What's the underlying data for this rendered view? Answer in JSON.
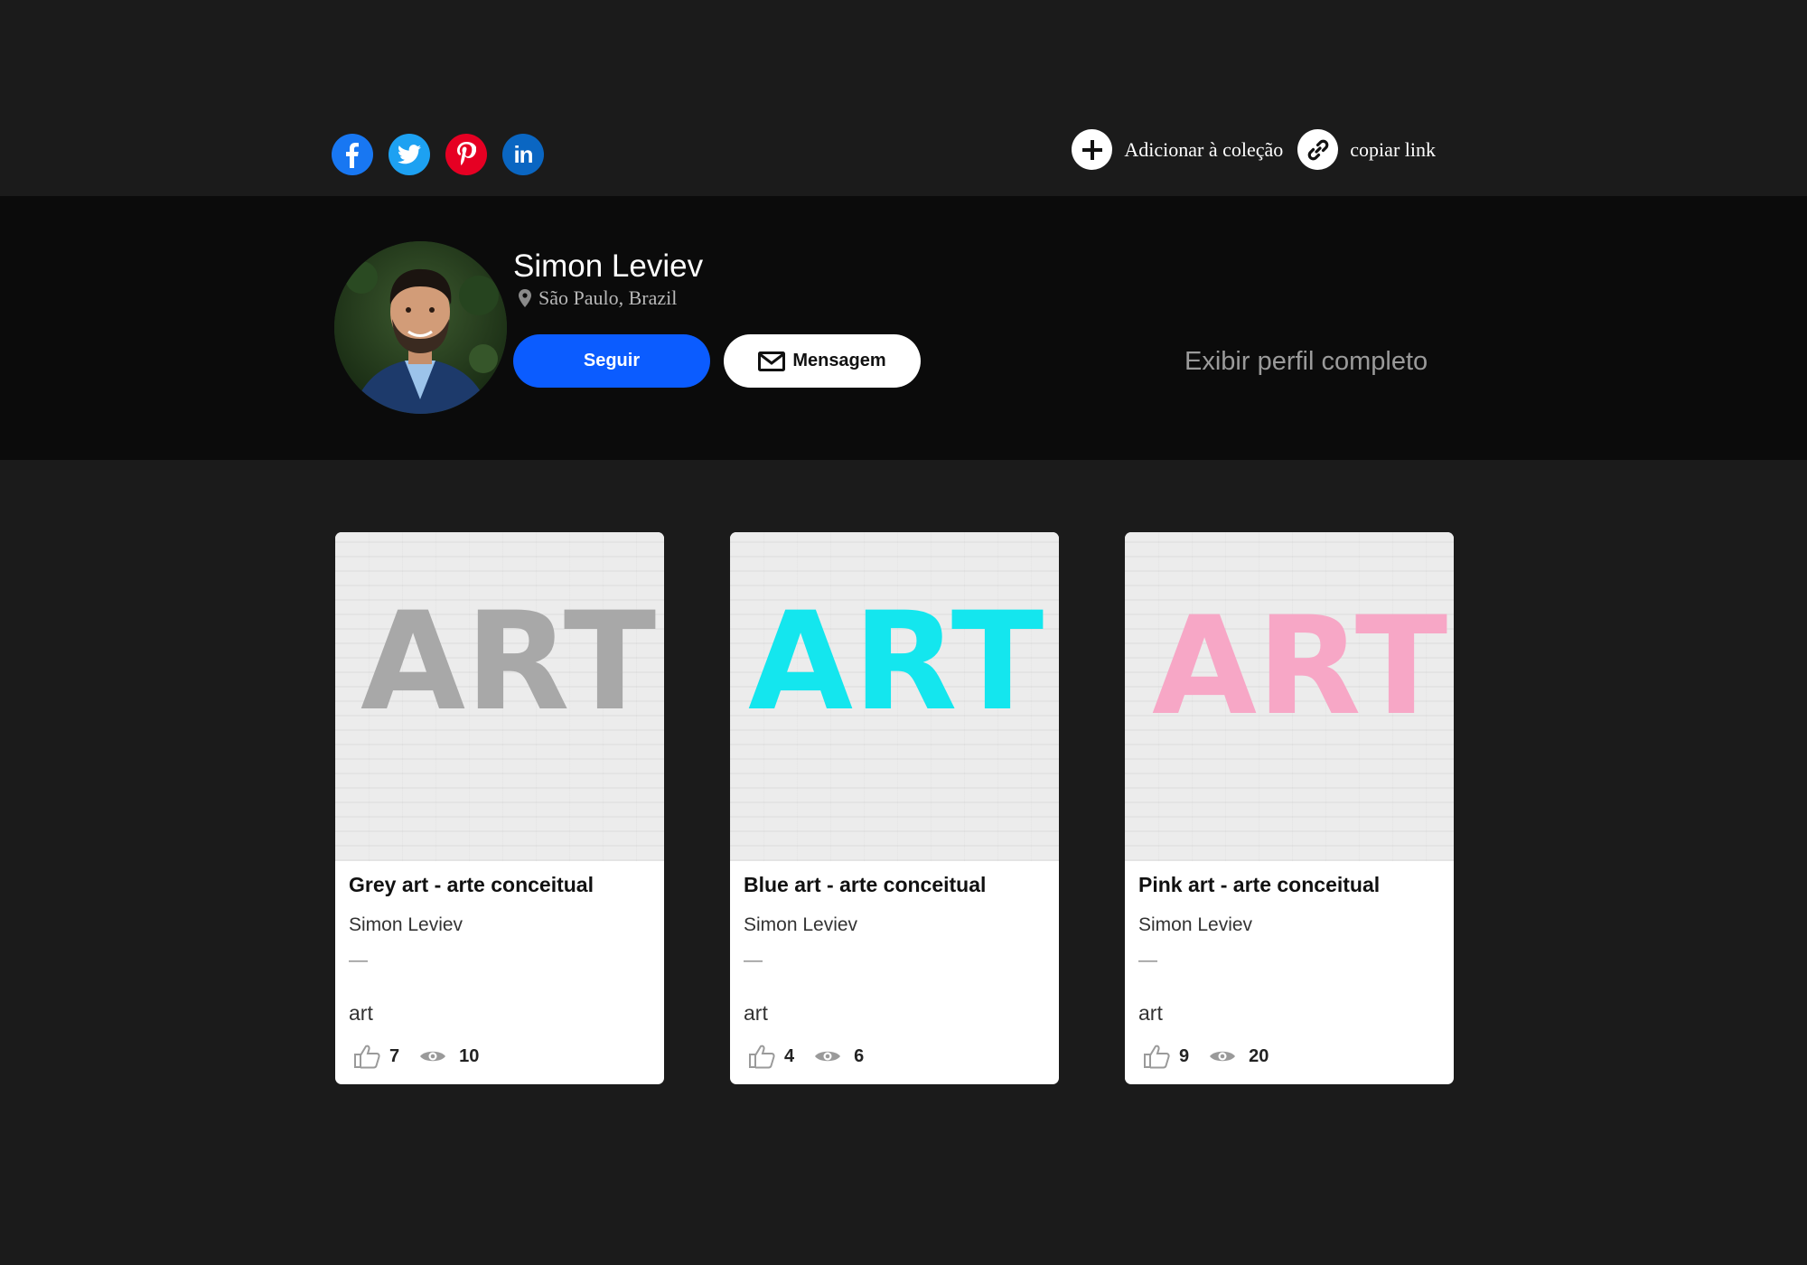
{
  "share": {
    "social": [
      "facebook-icon",
      "twitter-icon",
      "pinterest-icon",
      "linkedin-icon"
    ],
    "linkedin_text": "in",
    "add_collection_label": "Adicionar à coleção",
    "copy_link_label": "copiar link"
  },
  "profile": {
    "name": "Simon Leviev",
    "location": "São Paulo, Brazil",
    "follow_label": "Seguir",
    "message_label": "Mensagem",
    "view_full_label": "Exibir perfil completo"
  },
  "colors": {
    "follow_button": "#0b5cff",
    "grey_art": "#a8a8a8",
    "blue_art": "#14e6ee",
    "pink_art": "#f7a7c6"
  },
  "cards": [
    {
      "art_text": "ART",
      "art_color": "#a8a8a8",
      "title": "Grey art - arte conceitual",
      "author": "Simon Leviev",
      "dash": "—",
      "tag": "art",
      "likes": "7",
      "views": "10"
    },
    {
      "art_text": "ART",
      "art_color": "#14e6ee",
      "title": "Blue art - arte conceitual",
      "author": "Simon Leviev",
      "dash": "—",
      "tag": "art",
      "likes": "4",
      "views": "6"
    },
    {
      "art_text": "ART",
      "art_color": "#f7a7c6",
      "title": "Pink art - arte conceitual",
      "author": "Simon Leviev",
      "dash": "—",
      "tag": "art",
      "likes": "9",
      "views": "20"
    }
  ]
}
